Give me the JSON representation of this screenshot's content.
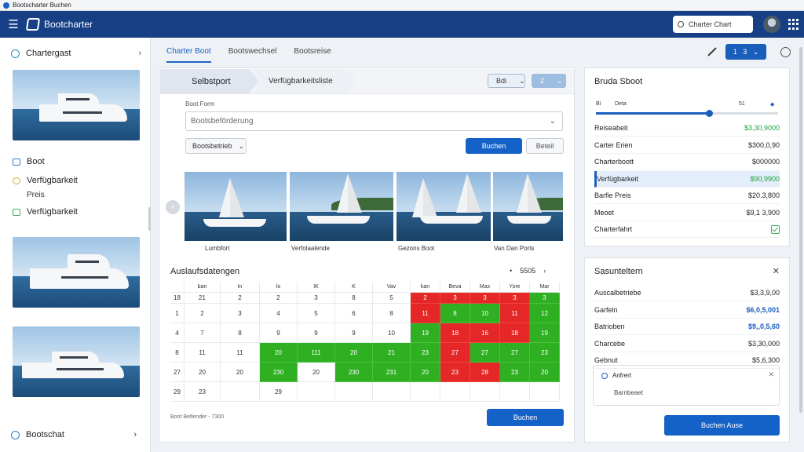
{
  "window": {
    "title": "Bootscharter Buchen"
  },
  "appbar": {
    "title": "Bootcharter",
    "search_text": "Charter Chart"
  },
  "sidebar": {
    "header": "Chartergast",
    "items": [
      {
        "label": "Boot"
      },
      {
        "label": "Verfügbarkeit"
      },
      {
        "label": "Preis"
      },
      {
        "label": "Verfügbarkeit"
      }
    ],
    "footer": "Bootschat"
  },
  "tabs": [
    {
      "label": "Charter Boot"
    },
    {
      "label": "Bootswechsel"
    },
    {
      "label": "Bootsreise"
    }
  ],
  "toolbar": {
    "seg_a": "1",
    "seg_b": "3"
  },
  "wizard": {
    "step1": "Selbstport",
    "step2": "Verfügbarkeitsliste",
    "dd_a": "Bdi",
    "dd_b": "2"
  },
  "form": {
    "label": "Boot Form",
    "select_value": "Bootsbeförderung",
    "filter": "Bootsbetrieb",
    "primary": "Buchen",
    "ghost": "Beteil"
  },
  "gallery": {
    "captions": [
      "Lumbfort",
      "Verfolaalende",
      "Gezons Boot",
      "Van Dan Ports"
    ]
  },
  "calendar": {
    "title": "Auslaufsdatengen",
    "nav_label": "5505",
    "headers": [
      "",
      "ban",
      "In",
      "lo",
      "IK",
      "K",
      "Vav",
      "kan",
      "Beva",
      "Max",
      "Yore",
      "Mar"
    ],
    "rows": [
      {
        "cells": [
          "18",
          "21",
          "2",
          "2",
          "3",
          "8",
          "5",
          "2",
          "3",
          "3",
          "3",
          "3"
        ],
        "status": [
          "",
          "",
          "",
          "",
          "",
          "",
          "",
          "r",
          "r",
          "r",
          "r",
          "g"
        ]
      },
      {
        "cells": [
          "1",
          "2",
          "3",
          "4",
          "5",
          "6",
          "8",
          "11",
          "8",
          "10",
          "11",
          "12"
        ],
        "status": [
          "",
          "",
          "",
          "",
          "",
          "",
          "",
          "r",
          "g",
          "g",
          "r",
          "g"
        ]
      },
      {
        "cells": [
          "4",
          "7",
          "8",
          "9",
          "9",
          "9",
          "10",
          "19",
          "18",
          "16",
          "18",
          "19"
        ],
        "status": [
          "",
          "",
          "",
          "",
          "",
          "",
          "",
          "g",
          "r",
          "r",
          "r",
          "g"
        ]
      },
      {
        "cells": [
          "8",
          "11",
          "11",
          "20",
          "111",
          "20",
          "21",
          "23",
          "27",
          "27",
          "27",
          "23"
        ],
        "status": [
          "",
          "",
          "",
          "g",
          "g",
          "g",
          "g",
          "g",
          "r",
          "g",
          "g",
          "g"
        ]
      },
      {
        "cells": [
          "27",
          "20",
          "20",
          "230",
          "20",
          "230",
          "231",
          "20",
          "23",
          "28",
          "23",
          "20"
        ],
        "status": [
          "",
          "",
          "",
          "g",
          "w",
          "g",
          "g",
          "g",
          "r",
          "r",
          "g",
          "g"
        ]
      },
      {
        "cells": [
          "29",
          "23",
          "",
          "29",
          "",
          "",
          "",
          "",
          "",
          "",
          "",
          ""
        ],
        "status": [
          "",
          "",
          "",
          "",
          "",
          "",
          "",
          "",
          "",
          "",
          "",
          ""
        ]
      }
    ],
    "footer": "Boot Betlender - 7300",
    "button": "Buchen"
  },
  "boat_panel": {
    "title": "Bruda Sboot",
    "slider_left": "Bi",
    "slider_mid": "Deta",
    "slider_right": "51",
    "slider_value": 0.62,
    "rows": [
      {
        "label": "Reiseabeit",
        "value": "$3,30,9000",
        "style": "green"
      },
      {
        "label": "Carter Erien",
        "value": "$300,0,90",
        "style": ""
      },
      {
        "label": "Charterboott",
        "value": "$000000",
        "style": ""
      },
      {
        "label": "Verfügbarkeit",
        "value": "$90,9900",
        "style": "green",
        "selected": true
      },
      {
        "label": "Barfie Preis",
        "value": "$20.3,800",
        "style": ""
      },
      {
        "label": "Meoet",
        "value": "$9,1 3,900",
        "style": ""
      },
      {
        "label": "Charterfahrt",
        "value": "",
        "style": "check"
      }
    ]
  },
  "summary_panel": {
    "title": "Sasunteltern",
    "rows": [
      {
        "label": "Auscalbetriebe",
        "value": "$3,3,9,00",
        "style": ""
      },
      {
        "label": "Garfeln",
        "value": "$6,0,5,001",
        "style": "blue"
      },
      {
        "label": "Batrioben",
        "value": "$9,,0,5,60",
        "style": "blue"
      },
      {
        "label": "Charcebe",
        "value": "$3,30,000",
        "style": ""
      },
      {
        "label": "Gebnut",
        "value": "$5,6,300",
        "style": ""
      }
    ],
    "note_title": "Anfrert",
    "note_body": "Barnbeaet",
    "button": "Buchen Ause"
  },
  "colors": {
    "brand": "#173f86",
    "primary": "#1462c8",
    "available": "#2fb023",
    "booked": "#e52727"
  }
}
